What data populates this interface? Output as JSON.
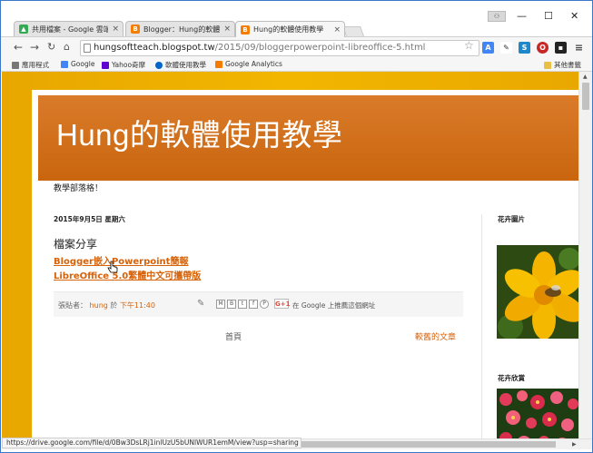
{
  "tabs": [
    {
      "label": "共用檔案 - Google 雲端硬碟",
      "favicon": "drive-icon",
      "color": "#34a853"
    },
    {
      "label": "Blogger：Hung的軟體使用教學",
      "favicon": "blogger-icon",
      "color": "#f57d00"
    },
    {
      "label": "Hung的軟體使用教學",
      "favicon": "blogger-icon",
      "color": "#f57d00"
    }
  ],
  "tab_close": "×",
  "window": {
    "minimize": "—",
    "maximize": "☐",
    "close": "✕"
  },
  "toolbar": {
    "url_host": "hungsoftteach.blogspot.tw",
    "url_path": "/2015/09/bloggerpowerpoint-libreoffice-5.html"
  },
  "bookmarks": [
    {
      "label": "應用程式",
      "icon": "apps-icon",
      "color": "#777"
    },
    {
      "label": "Google",
      "icon": "google-icon",
      "color": "#4285f4"
    },
    {
      "label": "Yahoo奇摩",
      "icon": "yahoo-icon",
      "color": "#5f01d1"
    },
    {
      "label": "軟體使用教學",
      "icon": "blogger-icon",
      "color": "#0066cc"
    },
    {
      "label": "Google Analytics",
      "icon": "analytics-icon",
      "color": "#f57c00"
    }
  ],
  "other_bookmarks": "其他書籤",
  "blog": {
    "title": "Hung的軟體使用教學",
    "description": "教學部落格！",
    "date": "2015年9月5日 星期六",
    "post_title": "檔案分享",
    "links": [
      "Blogger嵌入Powerpoint簡報",
      "LibreOffice 5.0繁體中文可攜帶版"
    ],
    "posted_by_label": "張貼者：",
    "author": "hung",
    "posted_at_label": "於",
    "time": "下午11:40",
    "google_share": "在 Google 上推薦這個網址",
    "home": "首頁",
    "older_posts": "較舊的文章",
    "sidebar_1": "花卉圖片",
    "sidebar_2": "花卉欣賞"
  },
  "share_buttons": [
    "M",
    "B",
    "t",
    "f",
    "P"
  ],
  "gplus": "G+1",
  "status_url": "https://drive.google.com/file/d/0Bw3DsLRj1inlUzU5bUNlWUR1emM/view?usp=sharing",
  "colors": {
    "accent": "#d6620a",
    "header": "#cc6a14",
    "background": "#f2b600"
  }
}
